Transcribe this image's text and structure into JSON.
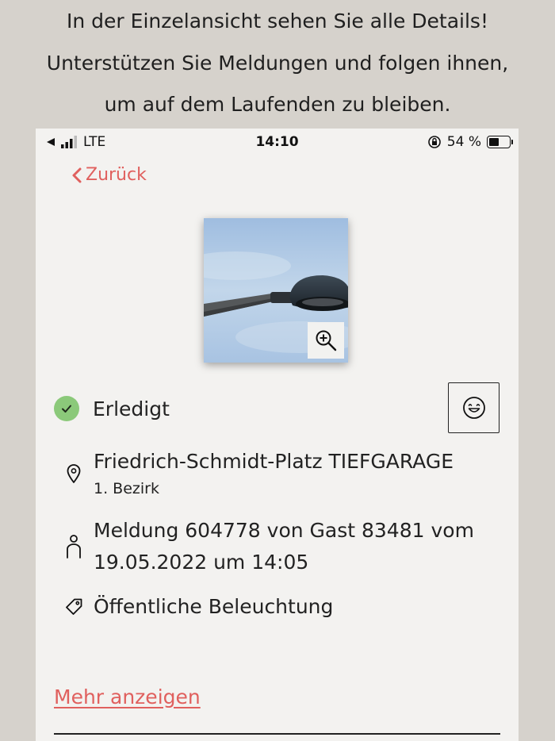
{
  "promo": {
    "line1": "In der Einzelansicht sehen Sie alle Details!",
    "line2": "Unterstützen Sie Meldungen und folgen ihnen,",
    "line3": "um auf dem Laufenden zu bleiben."
  },
  "statusbar": {
    "network": "LTE",
    "time": "14:10",
    "battery": "54 %",
    "battery_level": 0.54
  },
  "nav": {
    "back_label": "Zurück"
  },
  "report": {
    "status": "Erledigt",
    "location": "Friedrich-Schmidt-Platz TIEFGARAGE",
    "district": "1. Bezirk",
    "meta_line1": "Meldung 604778 von Gast 83481 vom",
    "meta_line2": "19.05.2022 um 14:05",
    "category": "Öffentliche Beleuchtung"
  },
  "actions": {
    "more_label": "Mehr anzeigen"
  },
  "colors": {
    "accent": "#e0605e",
    "done": "#8bc97a",
    "background": "#d6d2cc",
    "panel": "#f3f2f0"
  },
  "icons": [
    "back-chevron-icon",
    "zoom-in-icon",
    "check-icon",
    "smiley-icon",
    "location-pin-icon",
    "person-icon",
    "tag-icon",
    "location-arrow-icon",
    "signal-icon"
  ]
}
